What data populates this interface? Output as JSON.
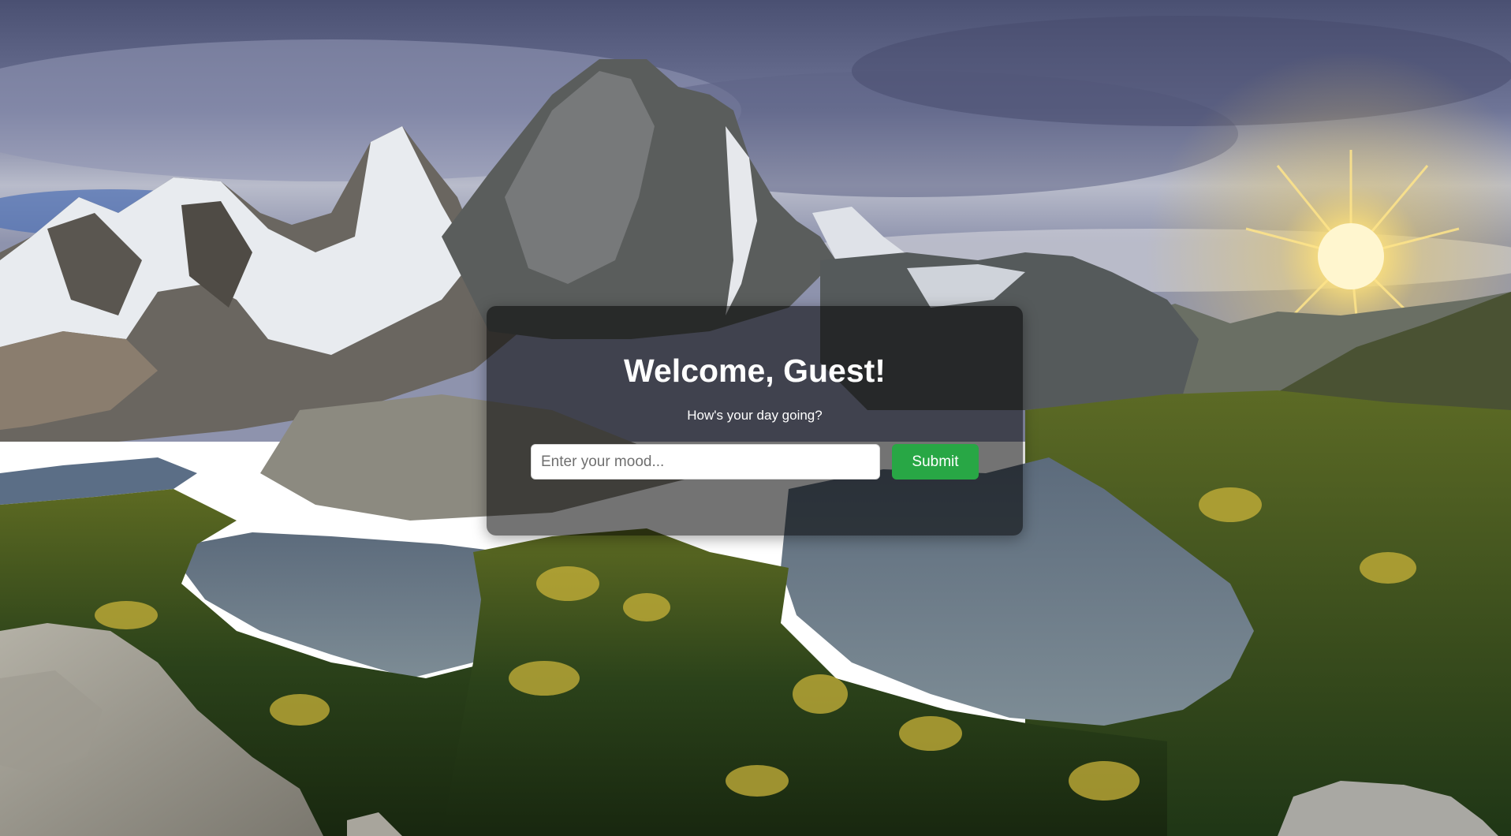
{
  "card": {
    "title": "Welcome, Guest!",
    "subtitle": "How's your day going?",
    "mood_placeholder": "Enter your mood...",
    "mood_value": "",
    "submit_label": "Submit"
  },
  "colors": {
    "submit_button": "#28a745",
    "card_overlay": "rgba(0,0,0,0.55)",
    "text": "#ffffff"
  }
}
